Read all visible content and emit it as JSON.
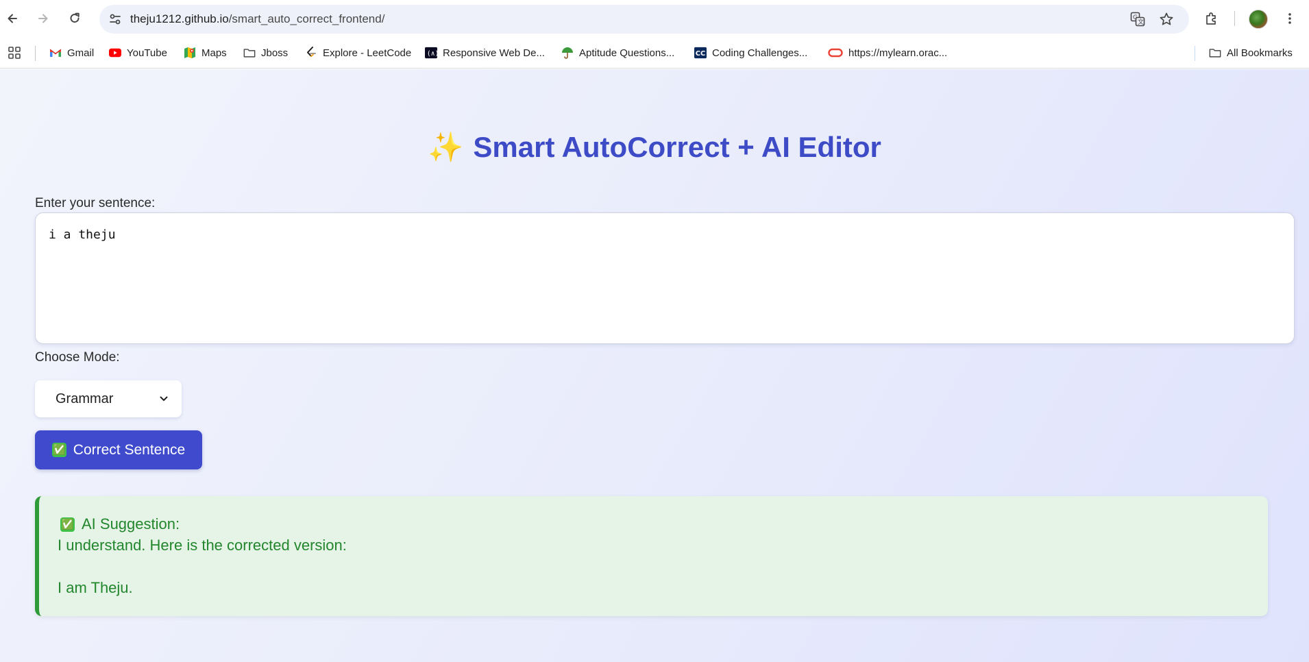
{
  "browser": {
    "url_host": "theju1212.github.io",
    "url_path": "/smart_auto_correct_frontend/",
    "bookmarks": [
      {
        "label": "Gmail",
        "icon": "gmail-icon"
      },
      {
        "label": "YouTube",
        "icon": "youtube-icon"
      },
      {
        "label": "Maps",
        "icon": "maps-icon"
      },
      {
        "label": "Jboss",
        "icon": "folder-icon"
      },
      {
        "label": "Explore - LeetCode",
        "icon": "leetcode-icon"
      },
      {
        "label": "Responsive Web De...",
        "icon": "freecodecamp-icon"
      },
      {
        "label": "Aptitude Questions...",
        "icon": "umbrella-icon"
      },
      {
        "label": "Coding Challenges...",
        "icon": "cc-icon"
      },
      {
        "label": "https://mylearn.orac...",
        "icon": "oracle-icon"
      }
    ],
    "all_bookmarks": "All Bookmarks",
    "colors": {
      "youtube": "#ff0000",
      "oracle": "#e94235",
      "cc_bg": "#0b2a5b"
    }
  },
  "app": {
    "title_icon": "✨",
    "title": "Smart AutoCorrect + AI Editor",
    "input_label": "Enter your sentence:",
    "input_value": "i a theju",
    "mode_label": "Choose Mode:",
    "mode_selected": "Grammar",
    "button_check": "✅",
    "button_label": "Correct Sentence",
    "suggestion_check": "✅",
    "suggestion_heading": "AI Suggestion:",
    "suggestion_lines": [
      "I understand. Here is the corrected version:",
      "",
      "I am Theju."
    ],
    "colors": {
      "accent": "#3f4bcc",
      "title": "#3d4bc7",
      "success_text": "#22862d",
      "success_bg": "#e5f4e6",
      "success_border": "#2e9a38"
    }
  }
}
